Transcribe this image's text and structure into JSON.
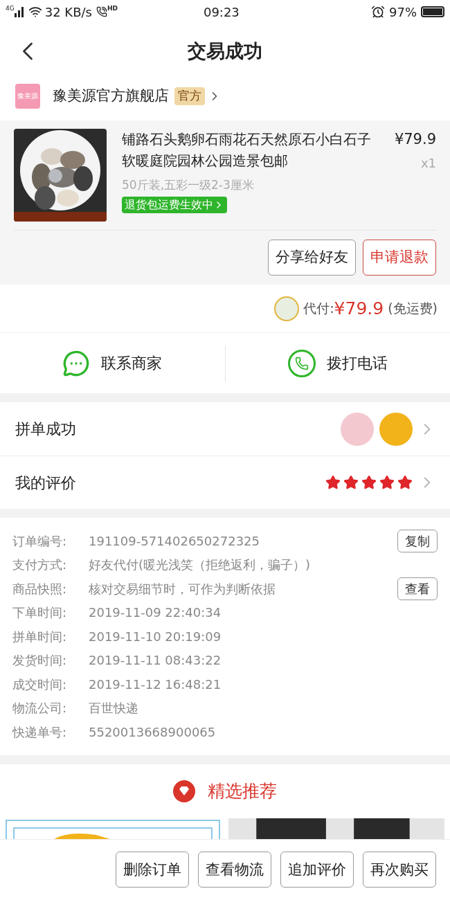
{
  "status_bar": {
    "network": "4G",
    "speed": "32 KB/s",
    "call": "HD",
    "time": "09:23",
    "battery": "97%"
  },
  "header": {
    "title": "交易成功"
  },
  "store": {
    "logo_text": "豫美源",
    "name": "豫美源官方旗舰店",
    "badge": "官方"
  },
  "product": {
    "title": "铺路石头鹅卵石雨花石天然原石小白石子软暖庭院园林公园造景包邮",
    "price": "¥79.9",
    "quantity": "x1",
    "spec": "50斤装,五彩一级2-3厘米",
    "tag": "退货包运费生效中"
  },
  "product_actions": [
    {
      "label": "分享给好友",
      "kind": "normal"
    },
    {
      "label": "申请退款",
      "kind": "danger"
    }
  ],
  "payment": {
    "label": "代付:",
    "amount": "¥79.9",
    "note": "(免运费)"
  },
  "contact": [
    {
      "label": "联系商家",
      "kind": "chat"
    },
    {
      "label": "拨打电话",
      "kind": "phone"
    }
  ],
  "group_rows": [
    {
      "label": "拼单成功",
      "kind": "avatars"
    },
    {
      "label": "我的评价",
      "kind": "stars",
      "stars": 5
    }
  ],
  "details": [
    {
      "label": "订单编号:",
      "value": "191109-571402650272325",
      "action": "复制"
    },
    {
      "label": "支付方式:",
      "value": "好友代付(暖光浅笑（拒绝返利，骗子）)"
    },
    {
      "label": "商品快照:",
      "value": "核对交易细节时，可作为判断依据",
      "action": "查看"
    },
    {
      "label": "下单时间:",
      "value": "2019-11-09 22:40:34"
    },
    {
      "label": "拼单时间:",
      "value": "2019-11-10 20:19:09"
    },
    {
      "label": "发货时间:",
      "value": "2019-11-11 08:43:22"
    },
    {
      "label": "成交时间:",
      "value": "2019-11-12 16:48:21"
    },
    {
      "label": "物流公司:",
      "value": "百世快递"
    },
    {
      "label": "快递单号:",
      "value": "5520013668900065"
    }
  ],
  "recommend": {
    "title": "精选推荐"
  },
  "bottom_actions": [
    "删除订单",
    "查看物流",
    "追加评价",
    "再次购买"
  ]
}
